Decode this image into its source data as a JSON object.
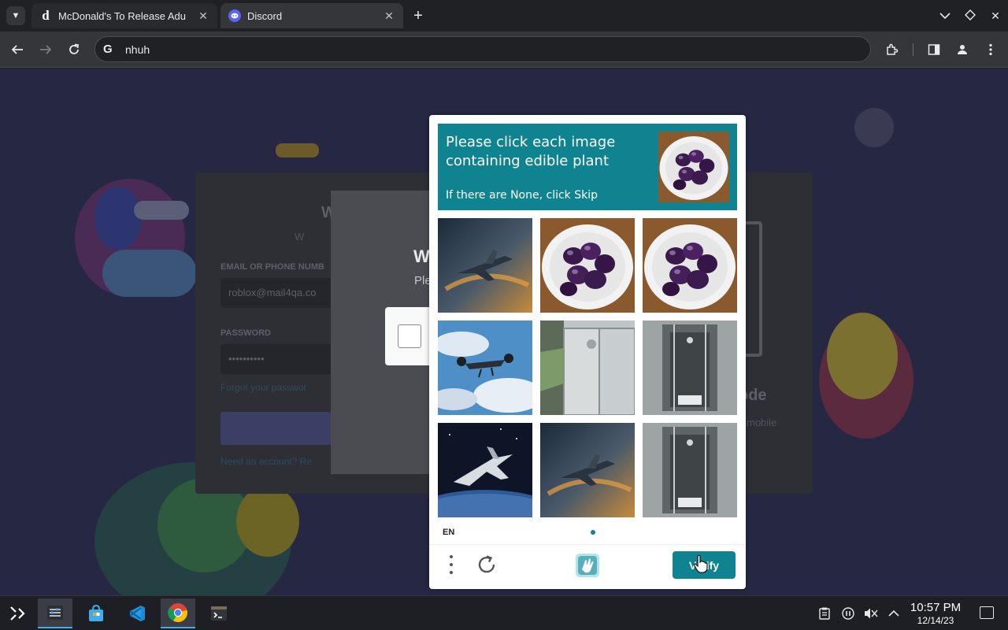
{
  "browser": {
    "tabs": [
      {
        "title": "McDonald's To Release Adu",
        "favicon": "d-letter-icon",
        "active": false
      },
      {
        "title": "Discord",
        "favicon": "discord-icon",
        "active": true
      }
    ],
    "address": "nhuh"
  },
  "page": {
    "login": {
      "title": "W",
      "subtitle": "W",
      "email_label": "EMAIL OR PHONE NUMB",
      "email_value": "roblox@mail4qa.co",
      "password_label": "PASSWORD",
      "password_value": "••••••••••",
      "forgot_link": "Forgot your passwor",
      "register_link": "Need an account? Re",
      "qr_title": "ode",
      "qr_sub": "mobile"
    },
    "modal": {
      "title": "W",
      "text": "Ple"
    }
  },
  "captcha": {
    "prompt": "Please click each image containing edible plant",
    "note": "If there are None, click Skip",
    "example": "plum-bowl",
    "images": [
      {
        "content": "jet-aircraft"
      },
      {
        "content": "plum-bowl"
      },
      {
        "content": "plum-bowl"
      },
      {
        "content": "drone-in-sky"
      },
      {
        "content": "glass-shower"
      },
      {
        "content": "shower-room"
      },
      {
        "content": "spacecraft"
      },
      {
        "content": "jet-aircraft"
      },
      {
        "content": "shower-room"
      }
    ],
    "language": "EN",
    "verify_label": "Verify",
    "accent": "#0f8390"
  },
  "taskbar": {
    "apps": [
      "app-launcher",
      "system-settings",
      "discover-store",
      "vscode",
      "chrome",
      "terminal"
    ],
    "time": "10:57 PM",
    "date": "12/14/23"
  }
}
